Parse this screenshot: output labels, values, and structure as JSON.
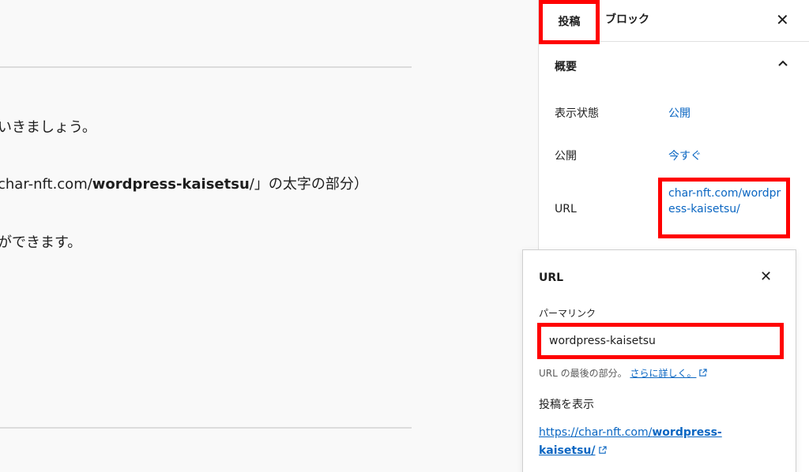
{
  "editor": {
    "line1": "いきましょう。",
    "line2_prefix": "char-nft.com/",
    "line2_bold": "wordpress-kaisetsu",
    "line2_suffix": "/」の太字の部分）",
    "line3": "ができます。"
  },
  "sidebar": {
    "tab_post": "投稿",
    "tab_block": "ブロック",
    "close_glyph": "✕",
    "panel_title": "概要",
    "rows": [
      {
        "label": "表示状態",
        "value": "公開"
      },
      {
        "label": "公開",
        "value": "今すぐ"
      },
      {
        "label": "URL",
        "value": "char-nft.com/wordpress-kaisetsu/"
      }
    ]
  },
  "popover": {
    "title": "URL",
    "close_glyph": "✕",
    "permalink_label": "パーマリンク",
    "slug_value": "wordpress-kaisetsu",
    "help_text": "URL の最後の部分。",
    "help_link": "さらに詳しく。",
    "view_post_label": "投稿を表示",
    "full_url_prefix": "https://char-nft.com/",
    "full_url_bold": "wordpress-kaisetsu/"
  },
  "colors": {
    "highlight": "#ff0000",
    "link": "#0a66c2"
  },
  "icons": {
    "close": "close-icon",
    "chevron": "chevron-up-icon",
    "external": "external-link-icon"
  }
}
